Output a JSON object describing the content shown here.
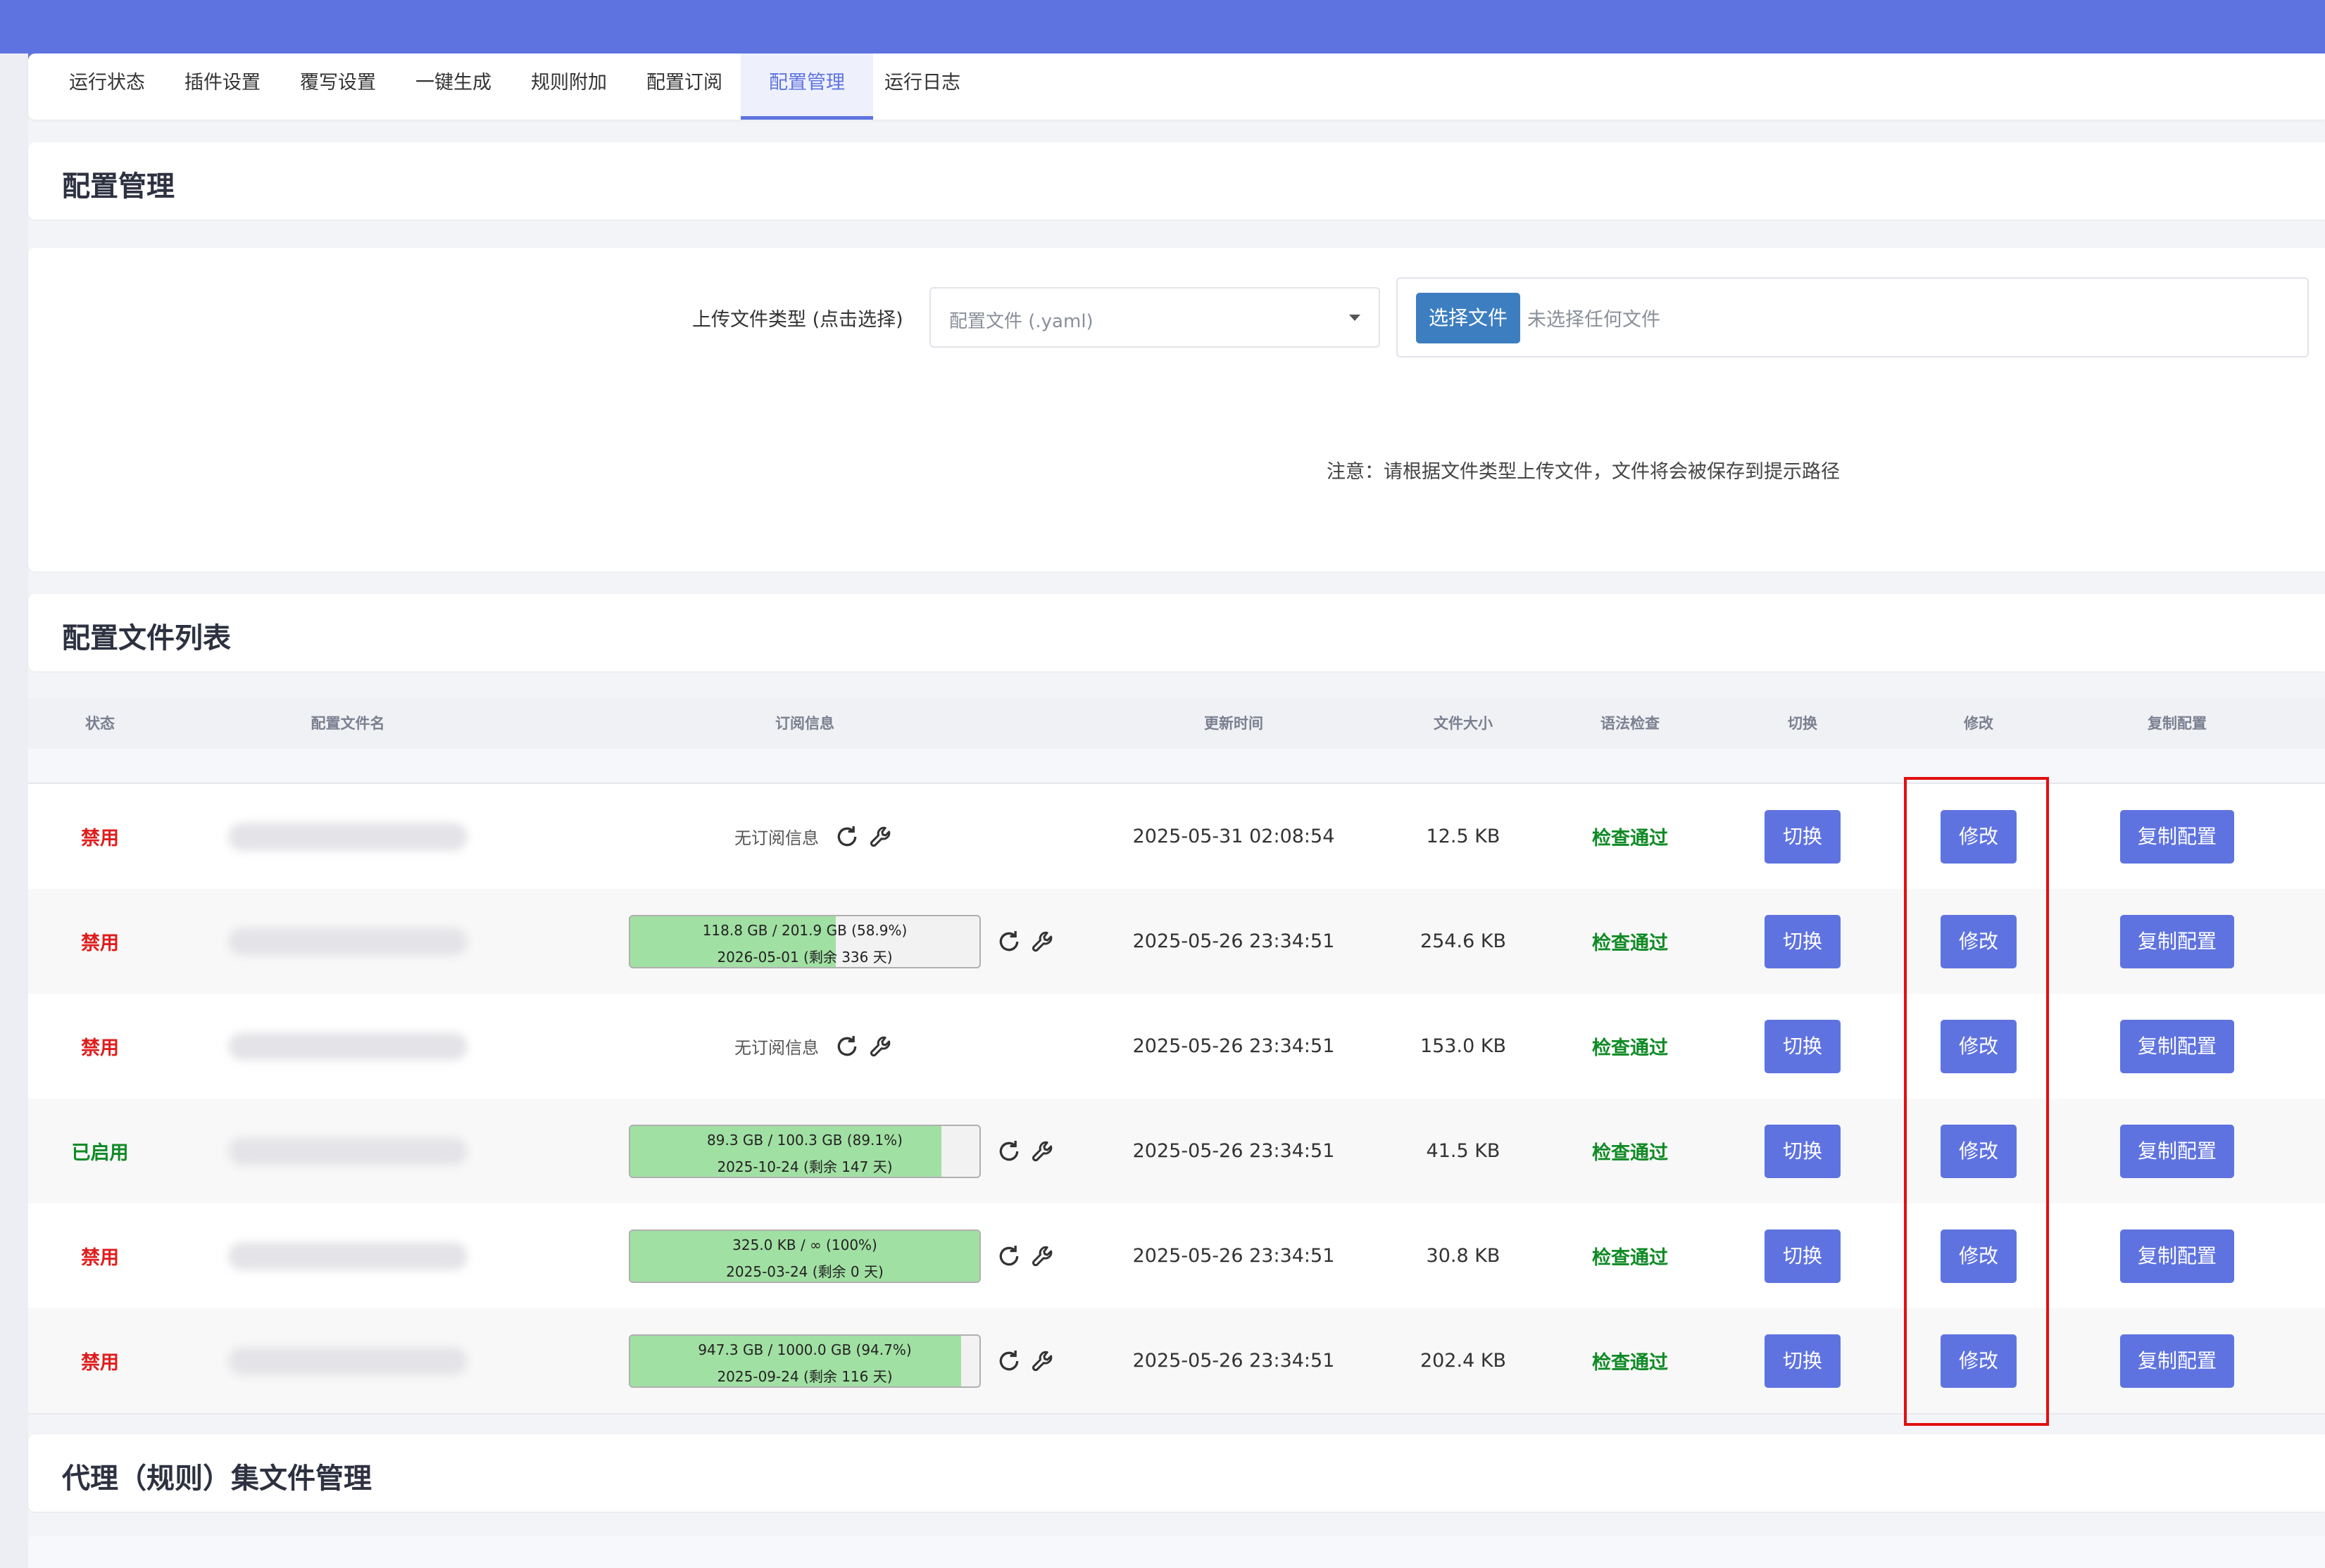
{
  "nav": {
    "tabs": [
      {
        "label": "运行状态",
        "active": false
      },
      {
        "label": "插件设置",
        "active": false
      },
      {
        "label": "覆写设置",
        "active": false
      },
      {
        "label": "一键生成",
        "active": false
      },
      {
        "label": "规则附加",
        "active": false
      },
      {
        "label": "配置订阅",
        "active": false
      },
      {
        "label": "配置管理",
        "active": true
      },
      {
        "label": "运行日志",
        "active": false
      }
    ]
  },
  "config_management": {
    "title": "配置管理"
  },
  "upload": {
    "type_label": "上传文件类型 (点击选择)",
    "type_selected": "配置文件 (.yaml)",
    "choose_file_label": "选择文件",
    "no_file_text": "未选择任何文件",
    "note": "注意：请根据文件类型上传文件，文件将会被保存到提示路径"
  },
  "config_list": {
    "title": "配置文件列表",
    "columns": [
      "状态",
      "配置文件名",
      "订阅信息",
      "更新时间",
      "文件大小",
      "语法检查",
      "切换",
      "修改",
      "复制配置"
    ],
    "rows": [
      {
        "status": "禁用",
        "enabled": false,
        "sub_has": false,
        "sub_text": "无订阅信息",
        "sub_line1": "",
        "sub_line2": "",
        "sub_ratio": 0,
        "time": "2025-05-31 02:08:54",
        "size": "12.5 KB",
        "check": "检查通过",
        "switch": "切换",
        "edit": "修改",
        "copy": "复制配置"
      },
      {
        "status": "禁用",
        "enabled": false,
        "sub_has": true,
        "sub_text": "",
        "sub_line1": "118.8 GB / 201.9 GB (58.9%)",
        "sub_line2": "2026-05-01 (剩余 336 天)",
        "sub_ratio": 0.589,
        "time": "2025-05-26 23:34:51",
        "size": "254.6 KB",
        "check": "检查通过",
        "switch": "切换",
        "edit": "修改",
        "copy": "复制配置"
      },
      {
        "status": "禁用",
        "enabled": false,
        "sub_has": false,
        "sub_text": "无订阅信息",
        "sub_line1": "",
        "sub_line2": "",
        "sub_ratio": 0,
        "time": "2025-05-26 23:34:51",
        "size": "153.0 KB",
        "check": "检查通过",
        "switch": "切换",
        "edit": "修改",
        "copy": "复制配置"
      },
      {
        "status": "已启用",
        "enabled": true,
        "sub_has": true,
        "sub_text": "",
        "sub_line1": "89.3 GB / 100.3 GB (89.1%)",
        "sub_line2": "2025-10-24 (剩余 147 天)",
        "sub_ratio": 0.891,
        "time": "2025-05-26 23:34:51",
        "size": "41.5 KB",
        "check": "检查通过",
        "switch": "切换",
        "edit": "修改",
        "copy": "复制配置"
      },
      {
        "status": "禁用",
        "enabled": false,
        "sub_has": true,
        "sub_text": "",
        "sub_line1": "325.0 KB / ∞ (100%)",
        "sub_line2": "2025-03-24 (剩余 0 天)",
        "sub_ratio": 1.0,
        "time": "2025-05-26 23:34:51",
        "size": "30.8 KB",
        "check": "检查通过",
        "switch": "切换",
        "edit": "修改",
        "copy": "复制配置"
      },
      {
        "status": "禁用",
        "enabled": false,
        "sub_has": true,
        "sub_text": "",
        "sub_line1": "947.3 GB / 1000.0 GB (94.7%)",
        "sub_line2": "2025-09-24 (剩余 116 天)",
        "sub_ratio": 0.947,
        "time": "2025-05-26 23:34:51",
        "size": "202.4 KB",
        "check": "检查通过",
        "switch": "切换",
        "edit": "修改",
        "copy": "复制配置"
      }
    ]
  },
  "proxy_section": {
    "title": "代理（规则）集文件管理"
  },
  "colors": {
    "accent": "#5f73e0",
    "enabled": "#0f8a25",
    "disabled": "#e01c1c",
    "highlight": "#e01010",
    "progress_fill": "#a1e0a3"
  }
}
